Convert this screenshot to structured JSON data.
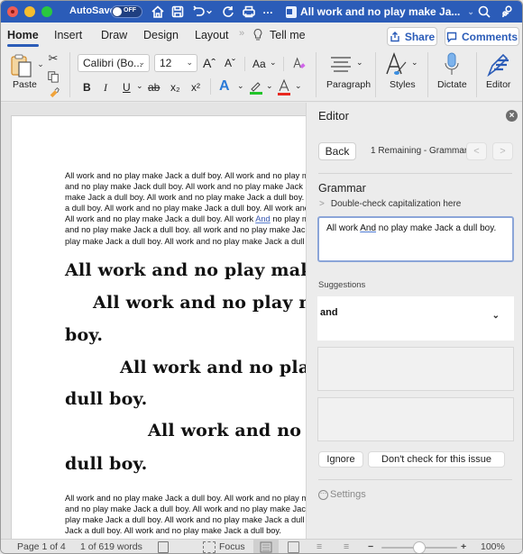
{
  "titlebar": {
    "autosave_label": "AutoSave",
    "autosave_state": "OFF",
    "more_label": "…",
    "doc_title": "All work and no play make Ja...",
    "icons": [
      "home-icon",
      "save-icon",
      "undo-icon",
      "redo-icon",
      "print-icon",
      "search-icon",
      "share-people-icon"
    ]
  },
  "tabs": {
    "items": [
      {
        "label": "Home",
        "active": true
      },
      {
        "label": "Insert",
        "active": false
      },
      {
        "label": "Draw",
        "active": false
      },
      {
        "label": "Design",
        "active": false
      },
      {
        "label": "Layout",
        "active": false
      }
    ],
    "more": "»",
    "tell_me": "Tell me",
    "share_label": "Share",
    "comments_label": "Comments"
  },
  "ribbon": {
    "paste_label": "Paste",
    "font_name": "Calibri (Bo...",
    "font_size": "12",
    "grow_font": "Aˆ",
    "shrink_font": "Aˇ",
    "change_case": "Aa",
    "bold": "B",
    "italic": "I",
    "underline": "U",
    "strikethrough": "ab",
    "subscript": "x₂",
    "superscript": "x²",
    "paragraph_label": "Paragraph",
    "styles_label": "Styles",
    "dictate_label": "Dictate",
    "editor_label": "Editor",
    "colors": {
      "highlight": "#22c42a",
      "font_color": "#e8281e",
      "text_effects": "#2b7ad8",
      "accent": "#2b5cb8"
    }
  },
  "document": {
    "para1": [
      "All work and no play make Jack a dulf boy. All work and no play make Jack a dull boy. All work",
      "and no play make Jack dull boy. All work and no play make Jack a dull boy. All work and no play",
      "make Jack a dull boy. All work and no play make Jack a dull boy. All work and no play make Jack",
      "a dull boy. All work and no play make Jack a dull boy. All work and no play make Jack a dull boy.",
      {
        "before": "All work and no play make Jack a dull boy. All work ",
        "flagged": "And",
        "after": " no play make Jack a dull boy. All work"
      },
      "and no play make Jack a dull boy. all work and no play make Jack a dull boy. All work and no",
      "play make Jack a dull boy. All work and no play make Jack a dull boy."
    ],
    "big_lines": [
      "All work and no play make Jack a dull boy.",
      "All work and no play make Jack a dull",
      "boy.",
      "All work and no play make Jack a",
      "dull boy.",
      "All work and no play make Jack a",
      "dull boy."
    ],
    "para2": [
      "All work and no play make Jack a dull boy. All work and no play make Jack a dull boy. All work",
      "and no play make Jack a dull boy. All work and no play make Jack a dull boy. All work and no",
      "play make Jack a dull boy. All work and no play make Jack a dull boy. All work and no play make",
      "Jack a dull boy. All work and no play make Jack a dull boy."
    ]
  },
  "editor": {
    "title": "Editor",
    "close_icon": "×",
    "back_label": "Back",
    "remaining": "1 Remaining - Grammar",
    "prev": "<",
    "next": ">",
    "category": "Grammar",
    "issue": "Double-check capitalization here",
    "issue_chevron": ">",
    "context_before": "All work ",
    "context_flagged": "And",
    "context_after": " no play make Jack a dull boy.",
    "suggestions_label": "Suggestions",
    "suggestion": "and",
    "suggestion_chevron": "⌄",
    "ignore_label": "Ignore",
    "dont_check_label": "Don't check for this issue",
    "settings_label": "Settings"
  },
  "status": {
    "page": "Page 1 of 4",
    "words": "1 of 619 words",
    "focus": "Focus",
    "zoom_minus": "−",
    "zoom_plus": "+",
    "zoom_level": "100%",
    "zoom_fraction": 0.5
  }
}
